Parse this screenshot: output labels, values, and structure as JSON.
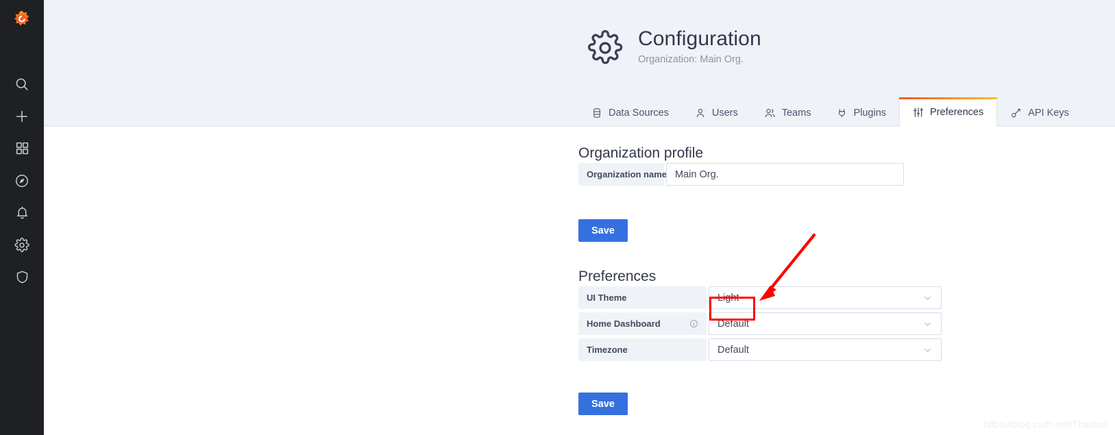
{
  "sidebar": {
    "brand_icon": "grafana-logo-icon",
    "items": [
      {
        "icon": "search-icon",
        "name": "search"
      },
      {
        "icon": "plus-icon",
        "name": "create"
      },
      {
        "icon": "dashboards-icon",
        "name": "dashboards"
      },
      {
        "icon": "compass-icon",
        "name": "explore"
      },
      {
        "icon": "bell-icon",
        "name": "alerting"
      },
      {
        "icon": "gear-icon",
        "name": "configuration"
      },
      {
        "icon": "shield-icon",
        "name": "server-admin"
      }
    ]
  },
  "header": {
    "icon": "gear-icon",
    "title": "Configuration",
    "subtitle": "Organization: Main Org.",
    "tabs": [
      {
        "label": "Data Sources",
        "icon": "database-icon",
        "active": false
      },
      {
        "label": "Users",
        "icon": "user-icon",
        "active": false
      },
      {
        "label": "Teams",
        "icon": "users-icon",
        "active": false
      },
      {
        "label": "Plugins",
        "icon": "plug-icon",
        "active": false
      },
      {
        "label": "Preferences",
        "icon": "sliders-icon",
        "active": true
      },
      {
        "label": "API Keys",
        "icon": "key-icon",
        "active": false
      }
    ],
    "active_tab_accent_from": "#f05a28",
    "active_tab_accent_to": "#fbbd2e"
  },
  "org_profile": {
    "section_title": "Organization profile",
    "org_name_label": "Organization name",
    "org_name_value": "Main Org.",
    "save_label": "Save"
  },
  "preferences": {
    "section_title": "Preferences",
    "rows": [
      {
        "label": "UI Theme",
        "value": "Light",
        "has_info": false
      },
      {
        "label": "Home Dashboard",
        "value": "Default",
        "has_info": true
      },
      {
        "label": "Timezone",
        "value": "Default",
        "has_info": false
      }
    ],
    "save_label": "Save",
    "chevron_icon": "chevron-down-icon",
    "info_icon": "info-circle-icon"
  },
  "annotations": {
    "highlight_color": "#fe0000",
    "highlight_target": "Light",
    "arrow_icon": "arrow-pointer-icon"
  },
  "watermark": {
    "text": "https://blog.csdn.net/Thanlon"
  },
  "colors": {
    "sidebar_bg": "#1f2024",
    "header_bg": "#eff2f7",
    "content_bg": "#ffffff",
    "primary_button": "#3571de",
    "text_primary": "#33384a",
    "text_muted": "#8e94a4"
  }
}
